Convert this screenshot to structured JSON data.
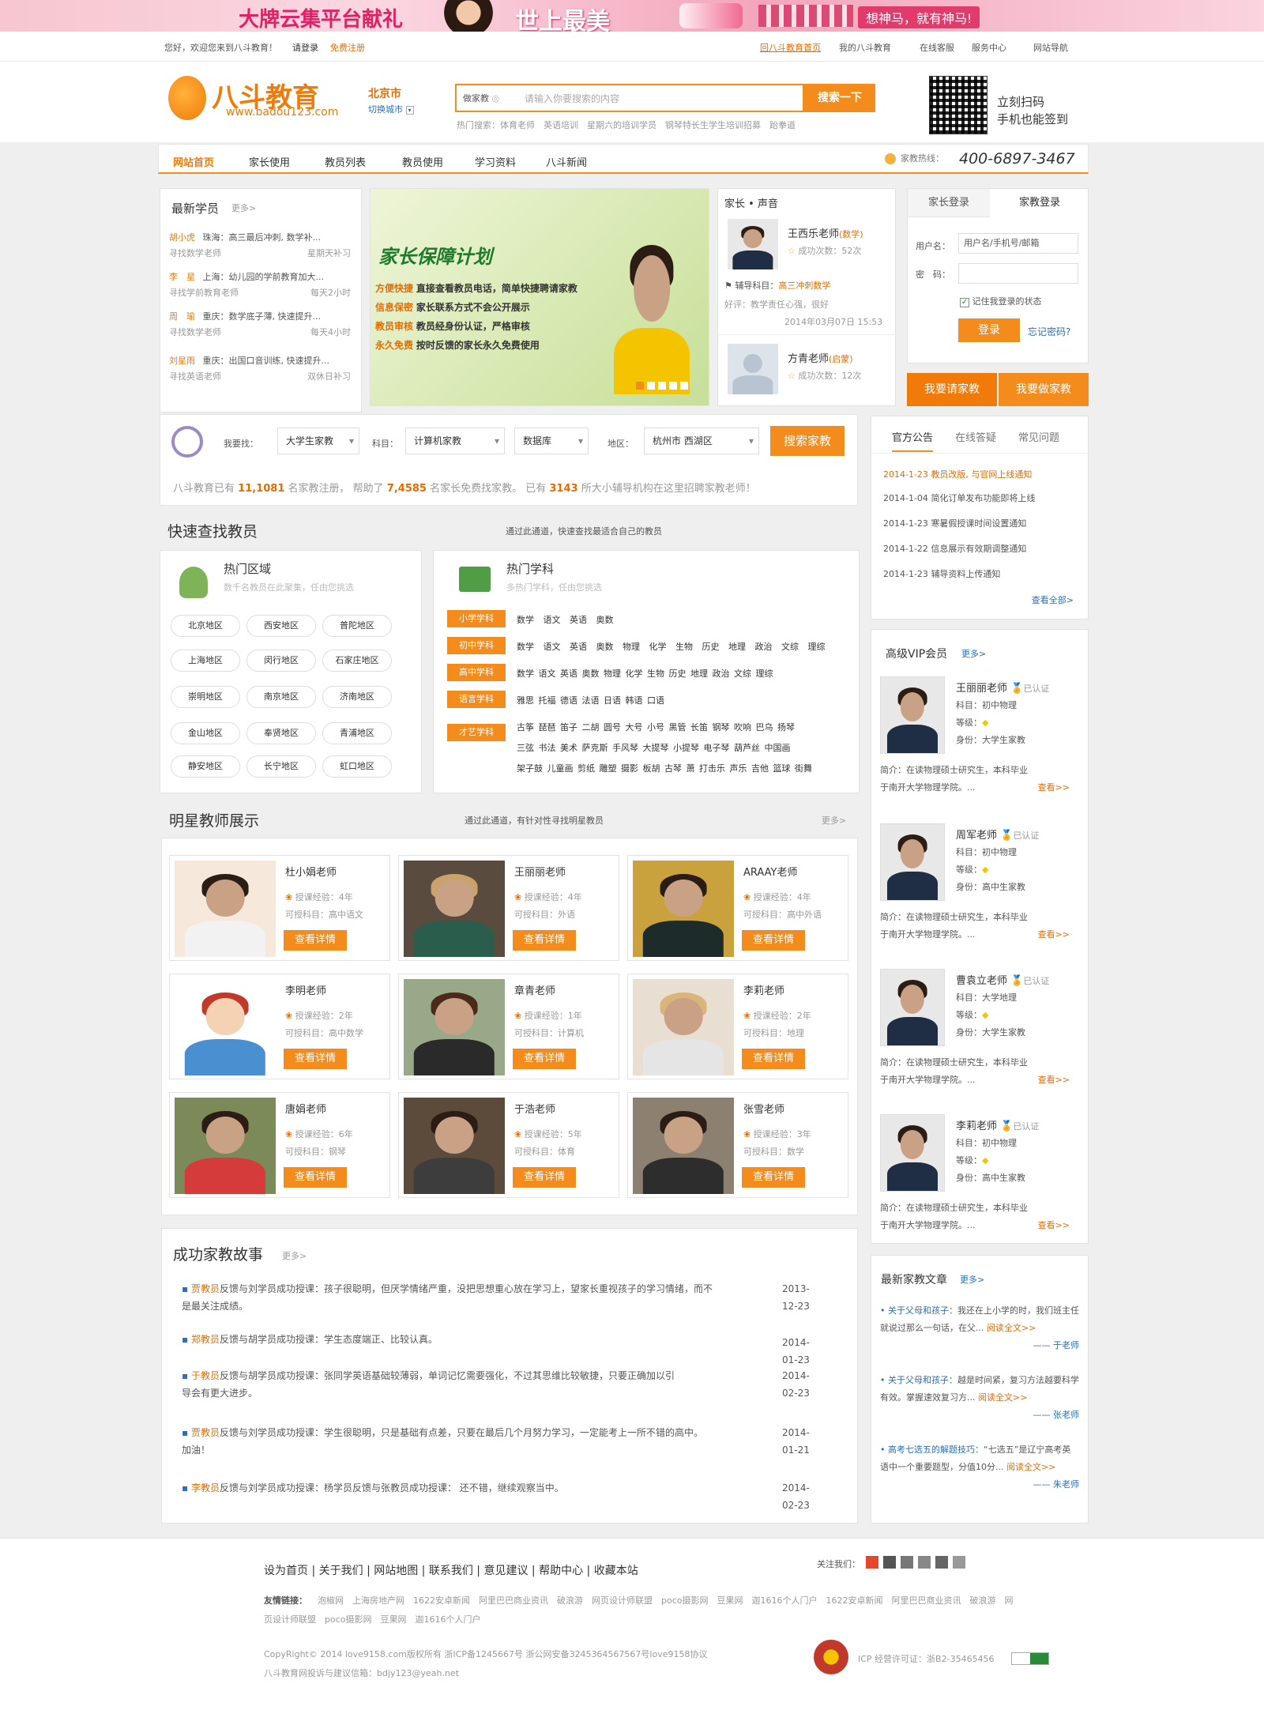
{
  "banner": {
    "t1": "大牌云集平台献礼",
    "t2": "世上最美",
    "t3": "想神马，就有神马!"
  },
  "topbar": {
    "welcome": "您好，欢迎您来到八斗教育！",
    "login": "请登录",
    "register": "免费注册",
    "links": [
      "回八斗教育首页",
      "我的八斗教育",
      "在线客服",
      "服务中心",
      "网站导航"
    ]
  },
  "header": {
    "logo": "八斗教育",
    "url": "www.badou123.com",
    "city": "北京市",
    "switch_city": "切换城市",
    "search_cat": "做家教",
    "search_ph": "请输入你要搜索的内容",
    "search_btn": "搜索一下",
    "hot": "热门搜索：体育老师　英语培训　星期六的培训学员　钢琴特长生学生培训招募　跆拳道",
    "slogan1": "立刻扫码",
    "slogan2": "手机也能签到"
  },
  "nav": {
    "items": [
      "网站首页",
      "家长使用",
      "教员列表",
      "教员使用",
      "学习资料",
      "八斗新闻"
    ],
    "hotline_label": "家教热线：",
    "hotline": "400-6897-3467"
  },
  "students": {
    "title": "最新学员",
    "more": "更多>",
    "items": [
      {
        "name": "胡小虎",
        "desc": "珠海：高三最后冲刺, 数学补...",
        "need": "寻找数学老师",
        "time": "星期天补习"
      },
      {
        "name": "李　星",
        "desc": "上海：幼儿园的学前教育加大...",
        "need": "寻找学前教育老师",
        "time": "每天2小时"
      },
      {
        "name": "周　瑜",
        "desc": "重庆：数学底子薄, 快速提升...",
        "need": "寻找数学老师",
        "time": "每天4小时"
      },
      {
        "name": "刘星雨",
        "desc": "重庆：出国口音训练, 快速提升...",
        "need": "寻找英语老师",
        "time": "双休日补习"
      }
    ]
  },
  "hero": {
    "title": "家长保障计划",
    "lines": [
      {
        "k": "方便快捷",
        "v": "直接查看教员电话，简单快捷聘请家教"
      },
      {
        "k": "信息保密",
        "v": "家长联系方式不会公开展示"
      },
      {
        "k": "教员审核",
        "v": "教员经身份认证，严格审核"
      },
      {
        "k": "永久免费",
        "v": "按时反馈的家长永久免费使用"
      }
    ]
  },
  "voice": {
    "title": "家长 • 声音",
    "t1": {
      "name": "王西乐老师",
      "subj": "(数学)",
      "count": "成功次数：52次",
      "course_label": "辅导科目：",
      "course": "高三冲刺数学",
      "review": "好评：教学责任心强，很好",
      "date": "2014年03月07日 15:53"
    },
    "t2": {
      "name": "方青老师",
      "subj": "(启蒙)",
      "count": "成功次数：12次"
    }
  },
  "login": {
    "tab1": "家长登录",
    "tab2": "家教登录",
    "user_label": "用户名：",
    "user_ph": "用户名/手机号/邮箱",
    "pwd_label": "密　码：",
    "remember": "记住我登录的状态",
    "btn": "登录",
    "forgot": "忘记密码?",
    "btn_hire": "我要请家教",
    "btn_teach": "我要做家教"
  },
  "filter": {
    "label": "我要找：",
    "v1": "大学生家教",
    "subj_label": "科目：",
    "v2": "计算机家教",
    "v3": "数据库",
    "area_label": "地区：",
    "v4": "杭州市 西湖区",
    "btn": "搜索家教",
    "stats_a": "八斗教育已有",
    "n1": "11,1081",
    "stats_b": "名家教注册， 帮助了",
    "n2": "7,4585",
    "stats_c": "名家长免费找家教。 已有",
    "n3": "3143",
    "stats_d": "所大小辅导机构在这里招聘家教老师！"
  },
  "notice": {
    "tabs": [
      "官方公告",
      "在线答疑",
      "常见问题"
    ],
    "items": [
      {
        "d": "2014-1-23",
        "t": "教员改版, 与官网上线通知"
      },
      {
        "d": "2014-1-04",
        "t": "简化订单发布功能即将上线"
      },
      {
        "d": "2014-1-23",
        "t": "寒暑假授课时间设置通知"
      },
      {
        "d": "2014-1-22",
        "t": "信息展示有效期调整通知"
      },
      {
        "d": "2014-1-23",
        "t": "辅导资料上传通知"
      }
    ],
    "all": "查看全部>"
  },
  "quick": {
    "title": "快速查找教员",
    "sub": "通过此通道，快速查找最适合自己的教员",
    "area_title": "热门区域",
    "area_sub": "数千名教员在此聚集，任由您挑选",
    "areas": [
      "北京地区",
      "西安地区",
      "普陀地区",
      "上海地区",
      "闵行地区",
      "石家庄地区",
      "崇明地区",
      "南京地区",
      "济南地区",
      "金山地区",
      "奉贤地区",
      "青浦地区",
      "静安地区",
      "长宁地区",
      "虹口地区"
    ],
    "subj_title": "热门学科",
    "subj_sub": "多热门学科，任由您挑选",
    "subjects": [
      {
        "label": "小学学科",
        "items": "数学 语文 英语 奥数"
      },
      {
        "label": "初中学科",
        "items": "数学 语文 英语 奥数 物理 化学 生物 历史 地理 政治 文综 理综"
      },
      {
        "label": "高中学科",
        "items": "数学 语文 英语 奥数 物理 化学 生物 历史 地理 政治 文综 理综"
      },
      {
        "label": "语言学科",
        "items": "雅思 托福 德语 法语 日语 韩语 口语"
      },
      {
        "label": "才艺学科",
        "items": "古筝 琵琶 笛子 二胡 圆号 大号 小号 黑管 长笛 钢琴 吹响 巴乌 扬琴"
      }
    ],
    "art2": "三弦 书法 美术 萨克斯 手风琴 大提琴 小提琴 电子琴 葫芦丝 中国画",
    "art3": "架子鼓 儿童画 剪纸 雕塑 摄影 板胡 古琴 萧 打击乐 声乐 吉他 篮球 街舞"
  },
  "stars": {
    "title": "明星教师展示",
    "sub": "通过此通道，有针对性寻找明星教员",
    "more": "更多>",
    "exp_label": "授课经验：",
    "subj_label": "可授科目：",
    "btn": "查看详情",
    "teachers": [
      {
        "name": "杜小娟老师",
        "exp": "4年",
        "subj": "高中语文"
      },
      {
        "name": "王丽丽老师",
        "exp": "4年",
        "subj": "外语"
      },
      {
        "name": "ARAAY老师",
        "exp": "4年",
        "subj": "高中外语"
      },
      {
        "name": "李明老师",
        "exp": "2年",
        "subj": "高中数学"
      },
      {
        "name": "章青老师",
        "exp": "1年",
        "subj": "计算机"
      },
      {
        "name": "李莉老师",
        "exp": "2年",
        "subj": "地理"
      },
      {
        "name": "唐娟老师",
        "exp": "6年",
        "subj": "钢琴"
      },
      {
        "name": "于浩老师",
        "exp": "5年",
        "subj": "体育"
      },
      {
        "name": "张雪老师",
        "exp": "3年",
        "subj": "数学"
      }
    ]
  },
  "vip": {
    "title": "高级VIP会员",
    "more": "更多>",
    "verified": "已认证",
    "subj_label": "科目：",
    "level_label": "等级：",
    "id_label": "身份：",
    "intro_label": "简介：",
    "more_link": "查看>>",
    "members": [
      {
        "name": "王丽丽老师",
        "subj": "初中物理",
        "id": "大学生家教",
        "intro1": "在读物理硕士研究生，本科毕业",
        "intro2": "于南开大学物理学院。..."
      },
      {
        "name": "周军老师",
        "subj": "初中物理",
        "id": "高中生家教",
        "intro1": "在读物理硕士研究生，本科毕业",
        "intro2": "于南开大学物理学院。..."
      },
      {
        "name": "曹袁立老师",
        "subj": "大学地理",
        "id": "大学生家教",
        "intro1": "在读物理硕士研究生，本科毕业",
        "intro2": "于南开大学物理学院。..."
      },
      {
        "name": "李莉老师",
        "subj": "初中物理",
        "id": "高中生家教",
        "intro1": "在读物理硕士研究生，本科毕业",
        "intro2": "于南开大学物理学院。..."
      }
    ]
  },
  "stories": {
    "title": "成功家教故事",
    "more": "更多>",
    "items": [
      {
        "n": "贾教员",
        "t": "反馈与刘学员成功授课：孩子很聪明，但厌学情绪严重，没把思想重心放在学习上，望家长重视孩子的学习情绪，而不",
        "t2": "是最关注成绩。",
        "d": "2013-12-23"
      },
      {
        "n": "郑教员",
        "t": "反馈与胡学员成功授课：学生态度端正、比较认真。",
        "t2": "",
        "d": "2014-01-23"
      },
      {
        "n": "于教员",
        "t": "反馈与胡学员成功授课：张同学英语基础较薄弱，单词记忆需要强化，不过其思维比较敏捷，只要正确加以引",
        "t2": "导会有更大进步。",
        "d": "2014-02-23"
      },
      {
        "n": "贾教员",
        "t": "反馈与刘学员成功授课：学生很聪明，只是基础有点差，只要在最后几个月努力学习，一定能考上一所不错的高中。",
        "t2": "加油！",
        "d": "2014-01-21"
      },
      {
        "n": "李教员",
        "t": "反馈与刘学员成功授课：杨学员反馈与张教员成功授课： 还不错，继续观察当中。",
        "t2": "",
        "d": "2014-02-23"
      }
    ]
  },
  "articles": {
    "title": "最新家教文章",
    "more": "更多>",
    "read": "阅读全文>>",
    "items": [
      {
        "h": "关于父母和孩子：",
        "t": "我还在上小学的时，我们班主任就说过那么一句话，在父...",
        "a": "—— 于老师"
      },
      {
        "h": "关于父母和孩子：",
        "t": "越是时间紧，复习方法越要科学有效。掌握速效复习方...",
        "a": "—— 张老师"
      },
      {
        "h": "高考七选五的解题技巧：",
        "t": "“七选五”是辽宁高考英语中一个重要题型，分值10分...",
        "a": "—— 朱老师"
      }
    ]
  },
  "footer": {
    "links": "设为首页 | 关于我们 | 网站地图 | 联系我们 | 意见建议 | 帮助中心 | 收藏本站",
    "follow": "关注我们：",
    "friend_label": "友情链接：",
    "friends": "泡椒网　上海房地产网　1622安卓新闻　阿里巴巴商业资讯　破浪游　网页设计师联盟　poco摄影网　豆果网　迦1616个人门户　1622安卓新闻　阿里巴巴商业资讯　破浪游　网",
    "friends2": "页设计师联盟　poco摄影网　豆果网　迦1616个人门户",
    "copy": "CopyRight© 2014 love9158.com版权所有 浙ICP备1245667号 浙公网安备3245364567567号love9158协议",
    "complaint": "八斗教育网投诉与建议信箱：bdjy123@yeah.net",
    "icp": "ICP 经营许可证：浙B2-35465456"
  },
  "colors": {
    "accent": "#f48b1d",
    "accent_text": "#e86b00"
  }
}
